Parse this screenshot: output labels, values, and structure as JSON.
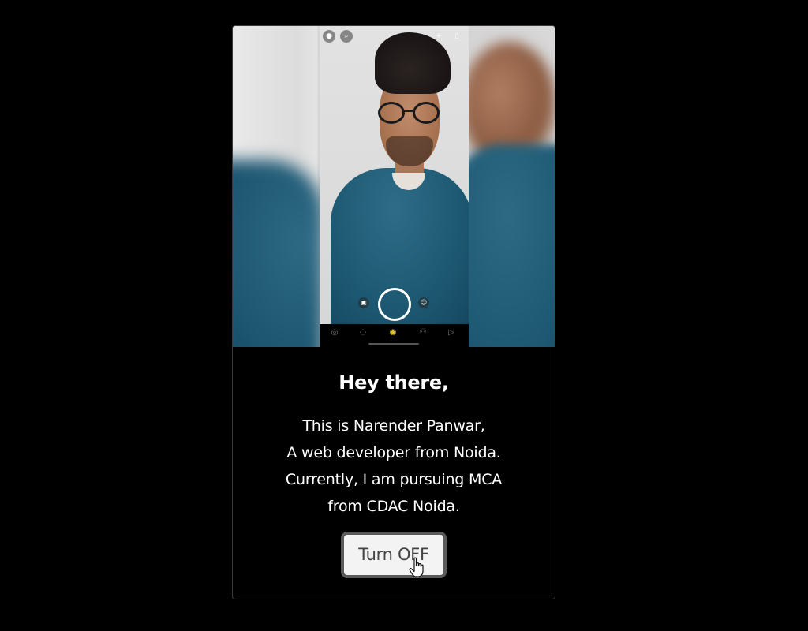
{
  "photo": {
    "top_icons": [
      "user-avatar-icon",
      "search-icon",
      "add-friend-icon",
      "flip-camera-icon"
    ],
    "nav_icons": [
      "map-icon",
      "chat-icon",
      "camera-icon",
      "stories-icon",
      "spotlight-icon"
    ]
  },
  "greeting": "Hey there,",
  "bio_lines": [
    "This is Narender Panwar,",
    "A web developer from Noida.",
    "Currently, I am pursuing MCA",
    "from CDAC Noida."
  ],
  "button": {
    "label": "Turn OFF"
  },
  "colors": {
    "background": "#000000",
    "text": "#ffffff",
    "button_bg": "#f3f3f3",
    "button_border": "#5a5a5a",
    "accent": "#e2c21c"
  }
}
